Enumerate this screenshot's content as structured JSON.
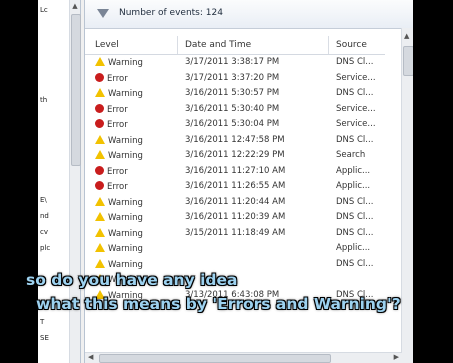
{
  "filter_bar": {
    "icon": "funnel-icon",
    "count_label": "Number of events: 124"
  },
  "columns": {
    "level": "Level",
    "date": "Date and Time",
    "source": "Source"
  },
  "rows": [
    {
      "level": "Warning",
      "icon": "warning-icon",
      "date": "3/17/2011 3:38:17 PM",
      "source": "DNS Cl..."
    },
    {
      "level": "Error",
      "icon": "error-icon",
      "date": "3/17/2011 3:37:20 PM",
      "source": "Service..."
    },
    {
      "level": "Warning",
      "icon": "warning-icon",
      "date": "3/16/2011 5:30:57 PM",
      "source": "DNS Cl..."
    },
    {
      "level": "Error",
      "icon": "error-icon",
      "date": "3/16/2011 5:30:40 PM",
      "source": "Service..."
    },
    {
      "level": "Error",
      "icon": "error-icon",
      "date": "3/16/2011 5:30:04 PM",
      "source": "Service..."
    },
    {
      "level": "Warning",
      "icon": "warning-icon",
      "date": "3/16/2011 12:47:58 PM",
      "source": "DNS Cl..."
    },
    {
      "level": "Warning",
      "icon": "warning-icon",
      "date": "3/16/2011 12:22:29 PM",
      "source": "Search"
    },
    {
      "level": "Error",
      "icon": "error-icon",
      "date": "3/16/2011 11:27:10 AM",
      "source": "Applic..."
    },
    {
      "level": "Error",
      "icon": "error-icon",
      "date": "3/16/2011 11:26:55 AM",
      "source": "Applic..."
    },
    {
      "level": "Warning",
      "icon": "warning-icon",
      "date": "3/16/2011 11:20:44 AM",
      "source": "DNS Cl..."
    },
    {
      "level": "Warning",
      "icon": "warning-icon",
      "date": "3/16/2011 11:20:39 AM",
      "source": "DNS Cl..."
    },
    {
      "level": "Warning",
      "icon": "warning-icon",
      "date": "3/15/2011 11:18:49 AM",
      "source": "DNS Cl..."
    },
    {
      "level": "Warning",
      "icon": "warning-icon",
      "date": "",
      "source": "Applic..."
    },
    {
      "level": "Warning",
      "icon": "warning-icon",
      "date": "",
      "source": "DNS Cl..."
    },
    {
      "level": "Warning",
      "icon": "warning-icon",
      "date": "",
      "source": ""
    },
    {
      "level": "Warning",
      "icon": "warning-icon",
      "date": "3/13/2011 6:43:08 PM",
      "source": "DNS Cl..."
    }
  ],
  "tree_fragments": [
    "Lc",
    "th",
    "E\\",
    "nd",
    "cv",
    "plc",
    "T",
    "SE"
  ],
  "subtitles": {
    "line1": "so do you have any idea",
    "line2": "what this means by 'Errors and Warning'?"
  },
  "colors": {
    "warning": "#f2c200",
    "error": "#c91d1d",
    "subtitle": "#9dd2f0"
  }
}
